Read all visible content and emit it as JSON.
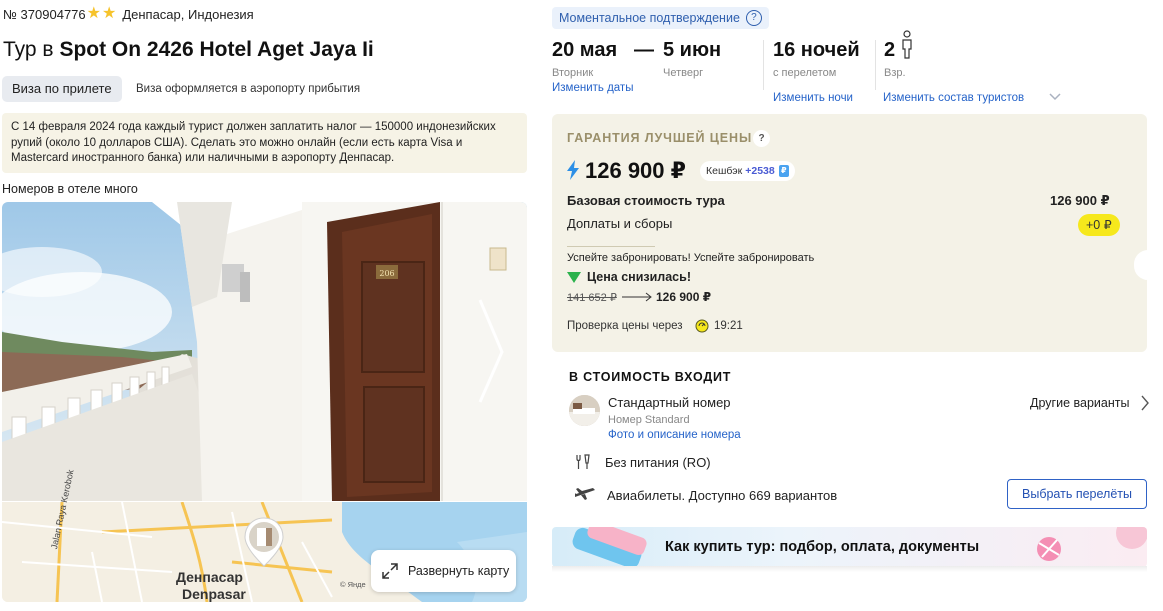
{
  "header": {
    "tour_id": "№ 370904776",
    "stars": 2,
    "location": "Денпасар, Индонезия",
    "title_prefix": "Тур в",
    "hotel_name": "Spot On 2426 Hotel Aget Jaya Ii"
  },
  "visa": {
    "badge": "Виза по прилете",
    "note": "Виза оформляется в аэропорту прибытия"
  },
  "tax_note": {
    "line1": "С 14 февраля 2024 года каждый турист должен заплатить налог — 150000 индонезийских",
    "line2": "рупий (около 10 долларов США). Сделать это можно онлайн (если есть карта Visa и",
    "line3": "Mastercard иностранного банка) или наличными в аэропорту Денпасар."
  },
  "rooms_note": "Номеров в отеле много",
  "photo": {
    "door_number": "206"
  },
  "map": {
    "street": "Jalan Raya Kerobok",
    "city": "Денпасар",
    "city_latin": "Denpasar",
    "copyright": "© Янде",
    "expand_label": "Развернуть карту"
  },
  "booking": {
    "instant_confirmation": "Моментальное подтверждение",
    "help_symbol": "?",
    "date_from": "20 мая",
    "date_dash": "—",
    "date_to": "5 июн",
    "weekday_from": "Вторник",
    "weekday_to": "Четверг",
    "change_dates": "Изменить даты",
    "nights": "16 ночей",
    "nights_note": "с перелетом",
    "change_nights": "Изменить ночи",
    "adults": "2",
    "adults_label": "Взр.",
    "change_tourists": "Изменить состав туристов"
  },
  "price_card": {
    "guarantee": "ГАРАНТИЯ ЛУЧШЕЙ ЦЕНЫ",
    "help_symbol": "?",
    "price": "126 900 ₽",
    "cashback_label": "Кешбэк",
    "cashback_value": "+2538",
    "base_label": "Базовая стоимость тура",
    "base_value": "126 900 ₽",
    "fees_label": "Доплаты и сборы",
    "fees_value": "+0 ₽",
    "hurry": "Успейте забронировать! Успейте забронировать",
    "price_dropped": "Цена снизилась!",
    "old_price": "141 652 ₽",
    "new_price": "126 900 ₽",
    "check_label": "Проверка цены через",
    "check_time": "19:21"
  },
  "included": {
    "title": "В СТОИМОСТЬ ВХОДИТ",
    "room_name": "Стандартный номер",
    "room_type": "Номер Standard",
    "room_link": "Фото и описание номера",
    "other_variants": "Другие варианты",
    "meal": "Без питания (RO)",
    "flights": "Авиабилеты. Доступно 669 вариантов",
    "flights_button": "Выбрать перелёты"
  },
  "banner": {
    "text": "Как купить тур: подбор, оплата, документы"
  },
  "colors": {
    "link": "#2563c9",
    "star": "#f6c32b",
    "price_card_bg": "#f4f2e7",
    "fees_badge": "#f6e81c",
    "price_drop_green": "#2bb24c"
  }
}
